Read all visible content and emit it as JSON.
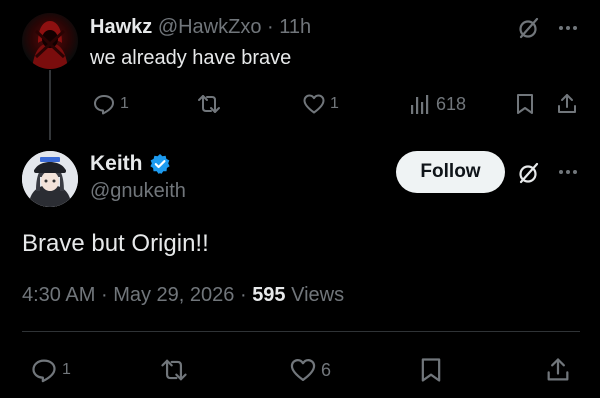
{
  "reply": {
    "name": "Hawkz",
    "handle": "@HawkZxo",
    "sep": "·",
    "time": "11h",
    "text": "we already have brave",
    "replies": "1",
    "likes": "1",
    "views": "618"
  },
  "tweet": {
    "name": "Keith",
    "handle": "@gnukeith",
    "follow_label": "Follow",
    "text": "Brave but Origin!!",
    "time": "4:30 AM",
    "sep1": "·",
    "date": "May 29, 2026",
    "sep2": "·",
    "views_count": "595",
    "views_label": "Views",
    "replies": "1",
    "likes": "6"
  },
  "colors": {
    "background": "#000000",
    "text": "#e7e9ea",
    "muted": "#71767b",
    "verified": "#1d9bf0",
    "follow_bg": "#eff3f4"
  },
  "icons": [
    "grok-icon",
    "more-icon",
    "reply-icon",
    "retweet-icon",
    "like-icon",
    "views-icon",
    "bookmark-icon",
    "share-icon",
    "verified-badge-icon"
  ]
}
